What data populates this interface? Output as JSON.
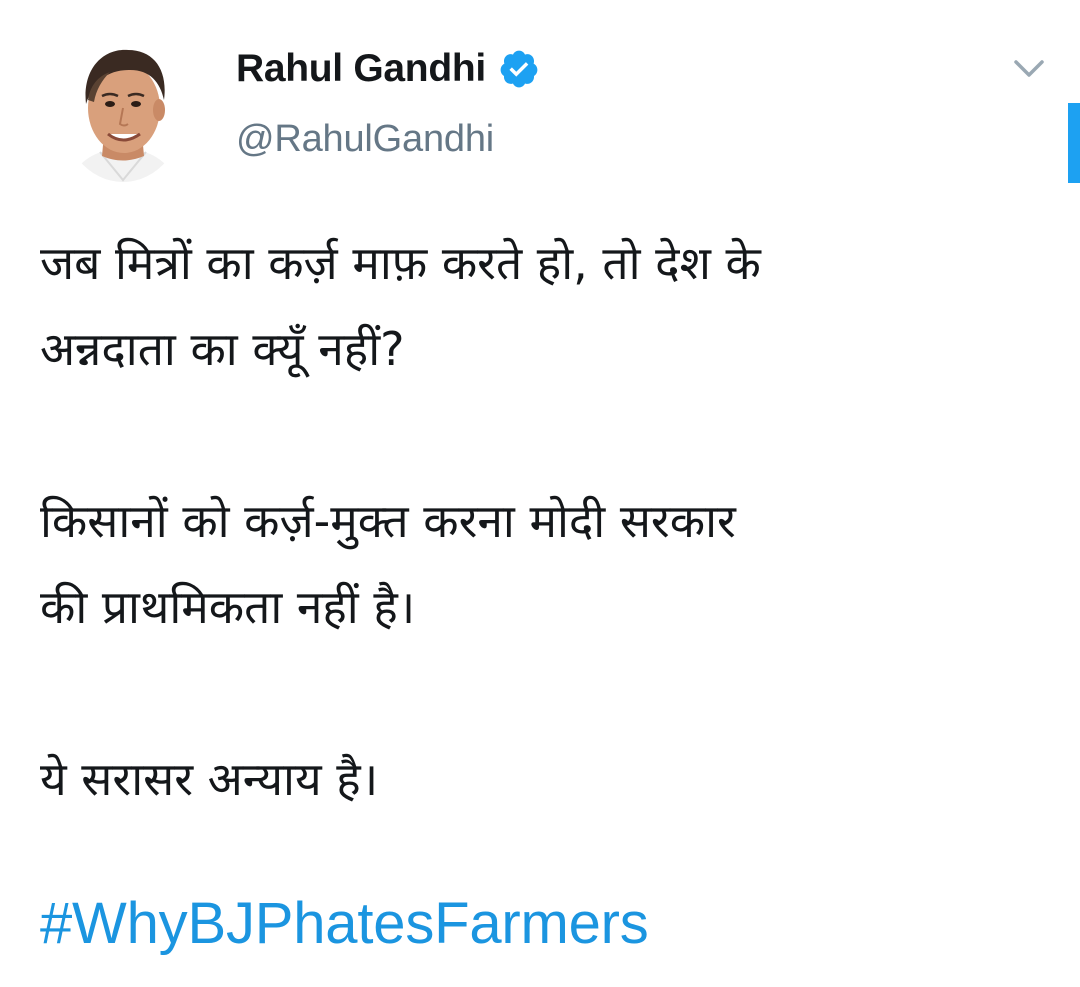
{
  "tweet": {
    "author": {
      "display_name": "Rahul Gandhi",
      "handle": "@RahulGandhi",
      "verified": true,
      "avatar_icon": "profile-photo"
    },
    "text_lines": [
      "जब मित्रों का कर्ज़ माफ़ करते हो, तो देश के",
      "अन्नदाता का क्यूँ नहीं?",
      "किसानों को कर्ज़-मुक्त करना मोदी सरकार",
      "की प्राथमिकता नहीं है।",
      "ये सरासर अन्याय है।"
    ],
    "hashtag": "#WhyBJPhatesFarmers"
  },
  "icons": {
    "verified": "verified-badge-icon",
    "menu": "chevron-down-icon"
  },
  "colors": {
    "link": "#1b95e0",
    "verified": "#1da1f2",
    "secondary_text": "#657786",
    "primary_text": "#14171a"
  }
}
